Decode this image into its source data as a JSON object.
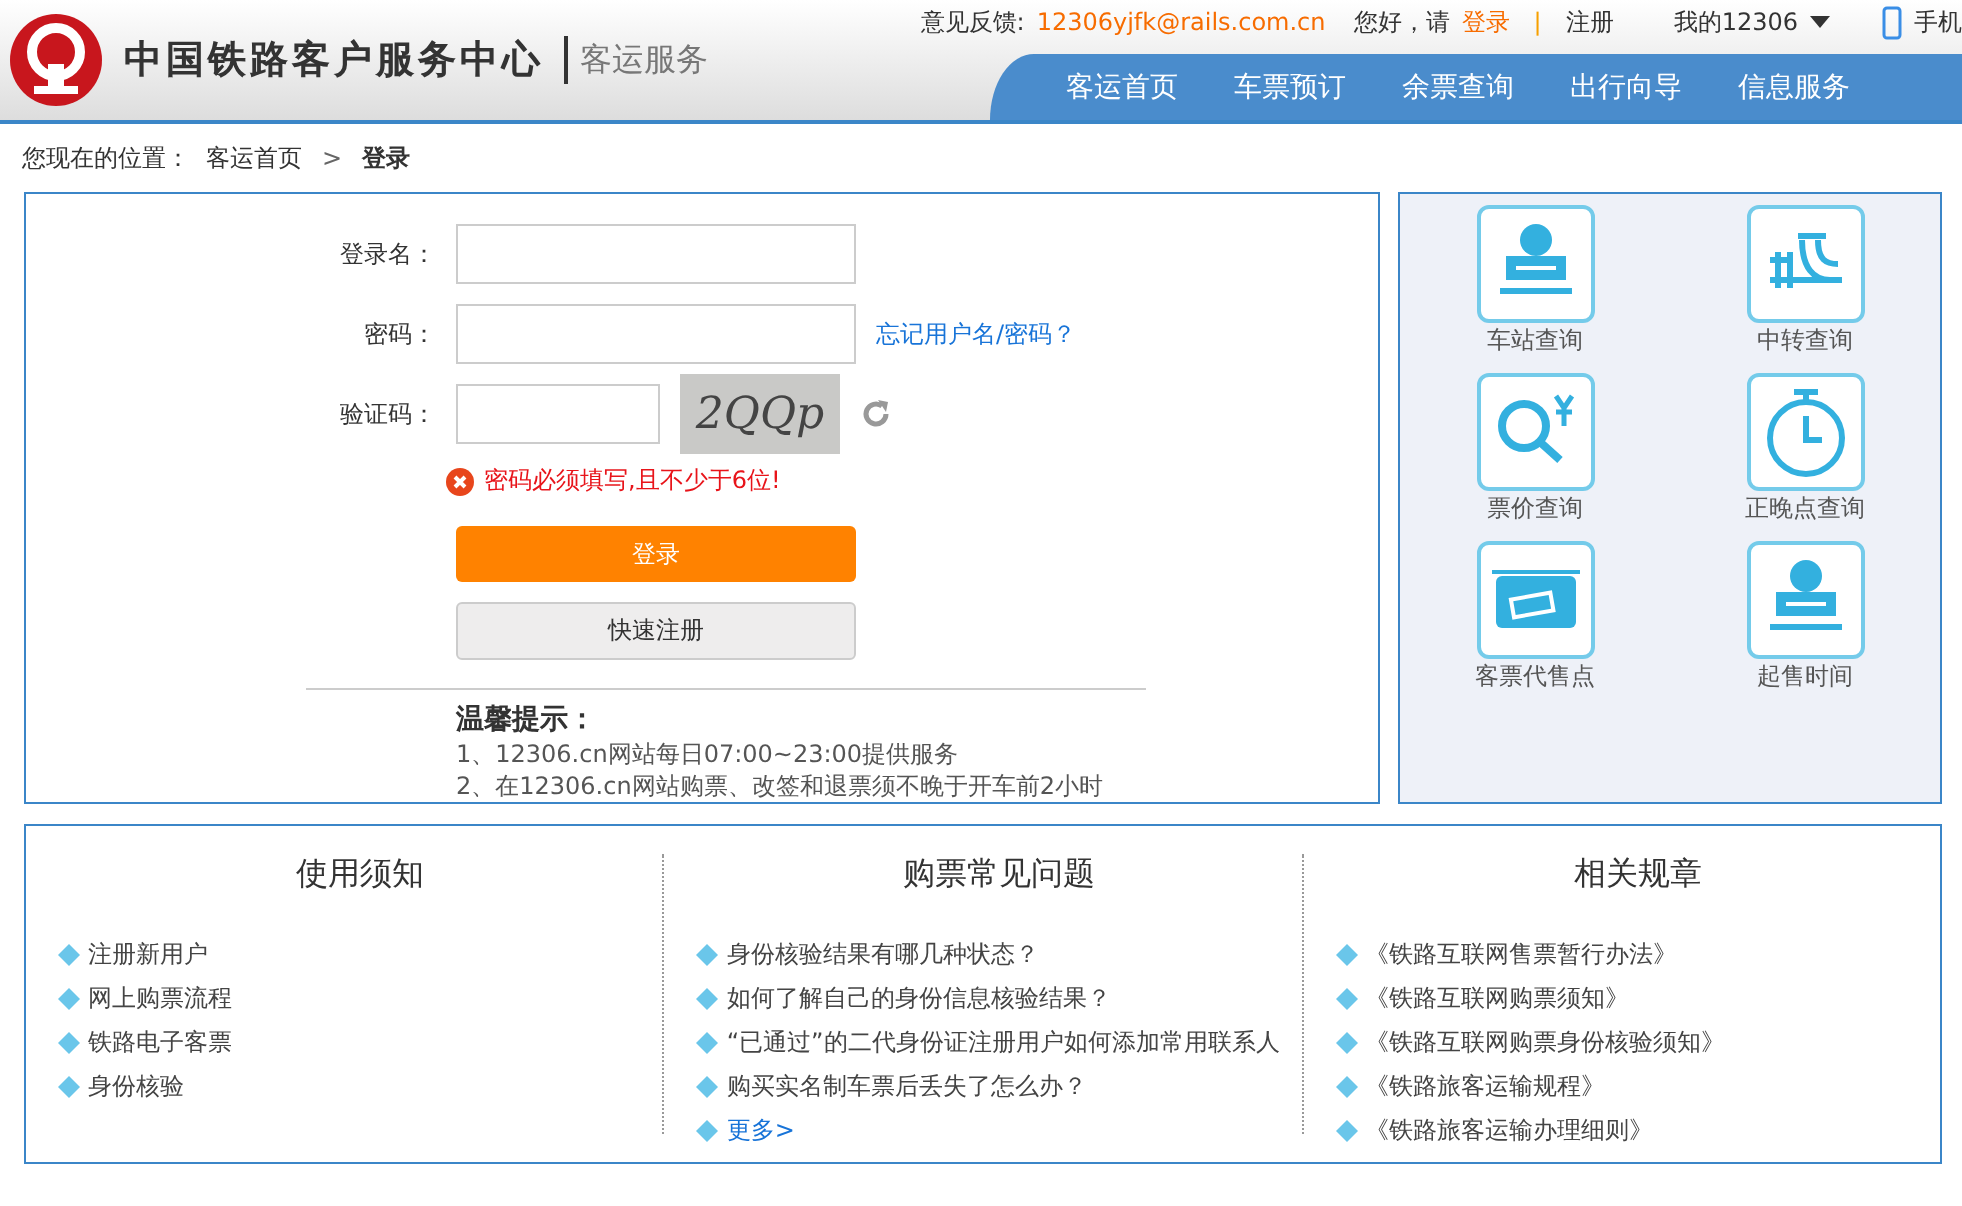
{
  "header": {
    "site_name": "中国铁路客户服务中心",
    "section": "客运服务",
    "feedback_label": "意见反馈:",
    "feedback_email": "12306yjfk@rails.com.cn",
    "greeting": "您好，请",
    "login_link": "登录",
    "separator": "|",
    "register_link": "注册",
    "my_account": "我的12306",
    "mobile": "手机"
  },
  "nav": [
    {
      "label": "客运首页",
      "selected": false
    },
    {
      "label": "车票预订",
      "selected": false
    },
    {
      "label": "余票查询",
      "selected": false
    },
    {
      "label": "出行向导",
      "selected": false
    },
    {
      "label": "信息服务",
      "selected": false
    }
  ],
  "breadcrumb": {
    "label": "您现在的位置：",
    "items": [
      "客运首页",
      "登录"
    ],
    "separator": ">"
  },
  "login": {
    "username_label": "登录名：",
    "password_label": "密码：",
    "forgot_link": "忘记用户名/密码？",
    "captcha_label": "验证码：",
    "captcha_text": "2QQp",
    "error": "密码必须填写,且不少于6位!",
    "login_button": "登录",
    "register_button": "快速注册",
    "tips_title": "温馨提示：",
    "tips": [
      "1、12306.cn网站每日07:00~23:00提供服务",
      "2、在12306.cn网站购票、改签和退票须不晚于开车前2小时"
    ]
  },
  "quick_links": [
    {
      "label": "车站查询",
      "kind": "station"
    },
    {
      "label": "中转查询",
      "kind": "transfer"
    },
    {
      "label": "票价查询",
      "kind": "price"
    },
    {
      "label": "正晚点查询",
      "kind": "clock"
    },
    {
      "label": "客票代售点",
      "kind": "ticket"
    },
    {
      "label": "起售时间",
      "kind": "station"
    }
  ],
  "info_columns": [
    {
      "title": "使用须知",
      "items": [
        "注册新用户",
        "网上购票流程",
        "铁路电子客票",
        "身份核验"
      ]
    },
    {
      "title": "购票常见问题",
      "items": [
        "身份核验结果有哪几种状态？",
        "如何了解自己的身份信息核验结果？",
        "“已通过”的二代身份证注册用户如何添加常用联系人",
        "购买实名制车票后丢失了怎么办？"
      ],
      "more": "更多>"
    },
    {
      "title": "相关规章",
      "items": [
        "《铁路互联网售票暂行办法》",
        "《铁路互联网购票须知》",
        "《铁路互联网购票身份核验须知》",
        "《铁路旅客运输规程》",
        "《铁路旅客运输办理细则》"
      ]
    }
  ]
}
